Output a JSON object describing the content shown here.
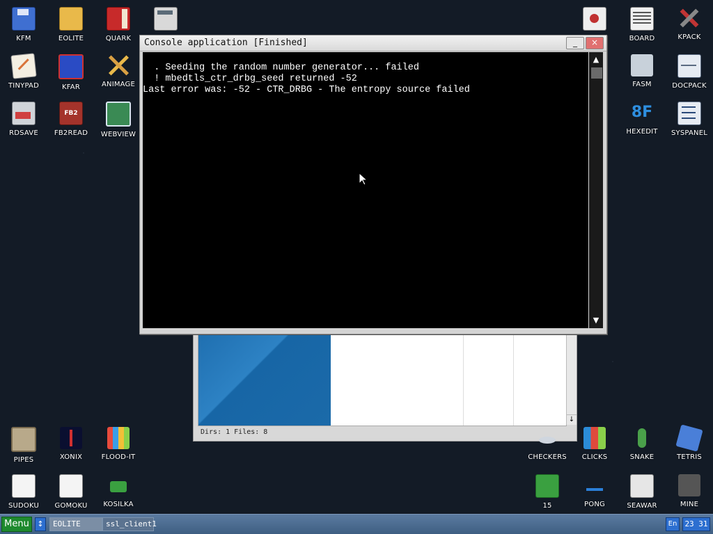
{
  "desktop": {
    "icons_left": [
      {
        "label": "KFM",
        "icon": "floppy-icon"
      },
      {
        "label": "EOLITE",
        "icon": "folder-icon"
      },
      {
        "label": "QUARK",
        "icon": "book-icon"
      },
      {
        "label": "TINYPAD",
        "icon": "notepad-icon"
      },
      {
        "label": "KFAR",
        "icon": "kfar-icon"
      },
      {
        "label": "ANIMAGE",
        "icon": "pencil-icon"
      },
      {
        "label": "RDSAVE",
        "icon": "rdsave-icon"
      },
      {
        "label": "FB2READ",
        "icon": "fb2-icon"
      },
      {
        "label": "WEBVIEW",
        "icon": "web-icon"
      }
    ],
    "icons_right": [
      {
        "label": "BOARD",
        "icon": "board-icon"
      },
      {
        "label": "KPACK",
        "icon": "kpack-icon"
      },
      {
        "label": "FASM",
        "icon": "fasm-icon"
      },
      {
        "label": "DOCPACK",
        "icon": "docpack-icon"
      },
      {
        "label": "HEXEDIT",
        "icon": "hexedit-icon"
      },
      {
        "label": "SYSPANEL",
        "icon": "syspanel-icon"
      }
    ],
    "icons_bottom_left": [
      {
        "label": "PIPES",
        "icon": "pipes-icon"
      },
      {
        "label": "XONIX",
        "icon": "xonix-icon"
      },
      {
        "label": "FLOOD-IT",
        "icon": "flood-icon"
      },
      {
        "label": "SUDOKU",
        "icon": "sudoku-icon"
      },
      {
        "label": "GOMOKU",
        "icon": "gomoku-icon"
      },
      {
        "label": "KOSILKA",
        "icon": "lawnmower-icon"
      }
    ],
    "icons_bottom_right": [
      {
        "label": "CHECKERS",
        "icon": "checkers-icon"
      },
      {
        "label": "CLICKS",
        "icon": "clicks-icon"
      },
      {
        "label": "SNAKE",
        "icon": "snake-icon"
      },
      {
        "label": "TETRIS",
        "icon": "tetris-icon"
      },
      {
        "label": "15",
        "icon": "fifteen-icon"
      },
      {
        "label": "PONG",
        "icon": "pong-icon"
      },
      {
        "label": "SEAWAR",
        "icon": "seawar-icon"
      },
      {
        "label": "MINE",
        "icon": "mine-icon"
      }
    ]
  },
  "console": {
    "title": "Console application [Finished]",
    "minimize": "_",
    "close": "×",
    "lines": [
      "  . Seeding the random number generator... failed",
      "  ! mbedtls_ctr_drbg_seed returned -52",
      "Last error was: -52 - CTR_DRBG - The entropy source failed"
    ],
    "scroll_up": "▲",
    "scroll_down": "▼"
  },
  "file_manager": {
    "status": "Dirs: 1   Files: 8",
    "scroll_down": "↓"
  },
  "taskbar": {
    "menu": "Menu",
    "switch": "↕",
    "tasks": [
      "EOLITE",
      "ssl_client1"
    ],
    "lang": "En",
    "clock": "23 31"
  }
}
